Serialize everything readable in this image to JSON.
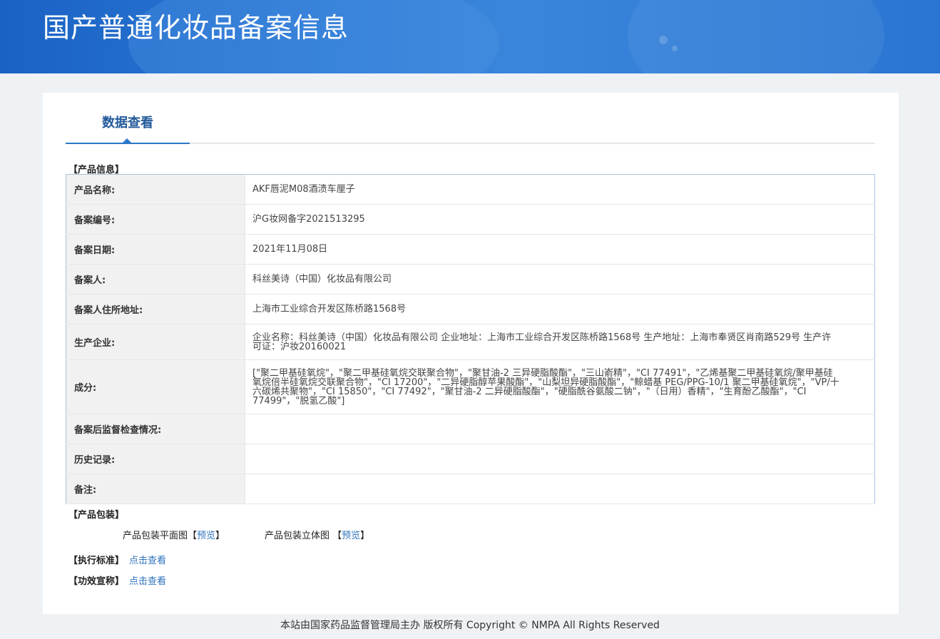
{
  "header": {
    "title": "国产普通化妆品备案信息"
  },
  "tab": {
    "label": "数据查看"
  },
  "product_info": {
    "section_title": "【产品信息】",
    "rows": [
      {
        "label": "产品名称:",
        "value": "AKF唇泥M08酒渍车厘子"
      },
      {
        "label": "备案编号:",
        "value": "沪G妆网备字2021513295"
      },
      {
        "label": "备案日期:",
        "value": "2021年11月08日"
      },
      {
        "label": "备案人:",
        "value": "科丝美诗（中国）化妆品有限公司"
      },
      {
        "label": "备案人住所地址:",
        "value": "上海市工业综合开发区陈桥路1568号"
      },
      {
        "label": "生产企业:",
        "value": "企业名称：科丝美诗（中国）化妆品有限公司 企业地址：上海市工业综合开发区陈桥路1568号 生产地址：上海市奉贤区肖南路529号 生产许可证：沪妆20160021"
      },
      {
        "label": "成分:",
        "value": "[\"聚二甲基硅氧烷\"，\"聚二甲基硅氧烷交联聚合物\"，\"聚甘油-2 三异硬脂酸酯\"，\"三山嵛精\"，\"CI 77491\"，\"乙烯基聚二甲基硅氧烷/聚甲基硅氧烷倍半硅氧烷交联聚合物\"，\"CI 17200\"，\"二异硬脂醇苹果酸酯\"，\"山梨坦异硬脂酸酯\"，\"鲸蜡基 PEG/PPG-10/1 聚二甲基硅氧烷\"，\"VP/十六碳烯共聚物\"，\"CI 15850\"，\"CI 77492\"，\"聚甘油-2 二异硬脂酸酯\"，\"硬脂酰谷氨酸二钠\"，\"（日用）香精\"，\"生育酚乙酸酯\"，\"CI 77499\"，\"脱氢乙酸\"]"
      },
      {
        "label": "备案后监督检查情况:",
        "value": ""
      },
      {
        "label": "历史记录:",
        "value": ""
      },
      {
        "label": "备注:",
        "value": ""
      }
    ]
  },
  "packaging": {
    "section_title": "【产品包装】",
    "flat_label": "产品包装平面图",
    "flat_link": "预览",
    "stereo_label": "产品包装立体图",
    "stereo_link": "预览"
  },
  "standard": {
    "section_title": "【执行标准】",
    "link": "点击查看"
  },
  "efficacy": {
    "section_title": "【功效宣称】",
    "link": "点击查看"
  },
  "footer": {
    "text": "本站由国家药品监督管理局主办 版权所有 Copyright © NMPA All Rights Reserved"
  }
}
